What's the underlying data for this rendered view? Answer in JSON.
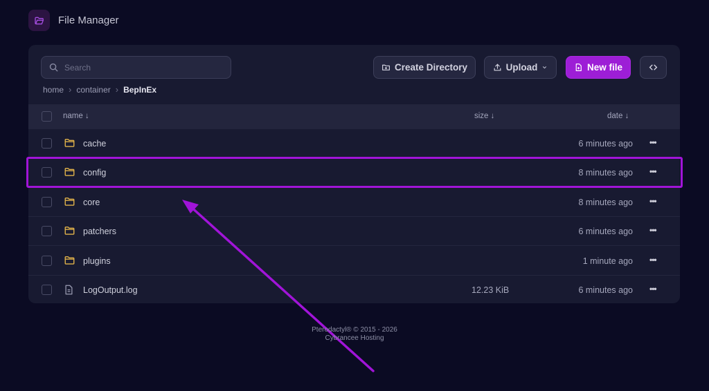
{
  "header": {
    "title": "File Manager"
  },
  "toolbar": {
    "search_placeholder": "Search",
    "create_directory": "Create Directory",
    "upload": "Upload",
    "new_file": "New file"
  },
  "breadcrumb": [
    "home",
    "container",
    "BepInEx"
  ],
  "table": {
    "columns": {
      "name": "name ↓",
      "size": "size ↓",
      "date": "date ↓"
    },
    "rows": [
      {
        "name": "cache",
        "type": "folder",
        "size": "",
        "date": "6 minutes ago"
      },
      {
        "name": "config",
        "type": "folder",
        "size": "",
        "date": "8 minutes ago"
      },
      {
        "name": "core",
        "type": "folder",
        "size": "",
        "date": "8 minutes ago"
      },
      {
        "name": "patchers",
        "type": "folder",
        "size": "",
        "date": "6 minutes ago"
      },
      {
        "name": "plugins",
        "type": "folder",
        "size": "",
        "date": "1 minute ago"
      },
      {
        "name": "LogOutput.log",
        "type": "file",
        "size": "12.23 KiB",
        "date": "6 minutes ago"
      }
    ]
  },
  "footer": {
    "line1": "Pterodactyl® © 2015 - 2026",
    "line2": "Cybrancee Hosting"
  },
  "colors": {
    "accent": "#9d1ed6",
    "folder": "#e2b34a",
    "background": "#0b0b23",
    "panel": "#181a31"
  }
}
